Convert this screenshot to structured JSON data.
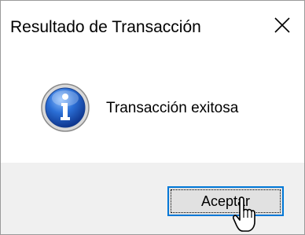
{
  "window": {
    "title": "Resultado de Transacción",
    "close_icon": "close-icon"
  },
  "content": {
    "icon": "info-icon",
    "message": "Transacción exitosa"
  },
  "footer": {
    "ok_label": "Aceptar"
  },
  "colors": {
    "footer_bg": "#f0f0f0",
    "button_bg": "#e1e1e1",
    "button_focus_border": "#0078d7",
    "icon_blue": "#1f5fbf"
  }
}
